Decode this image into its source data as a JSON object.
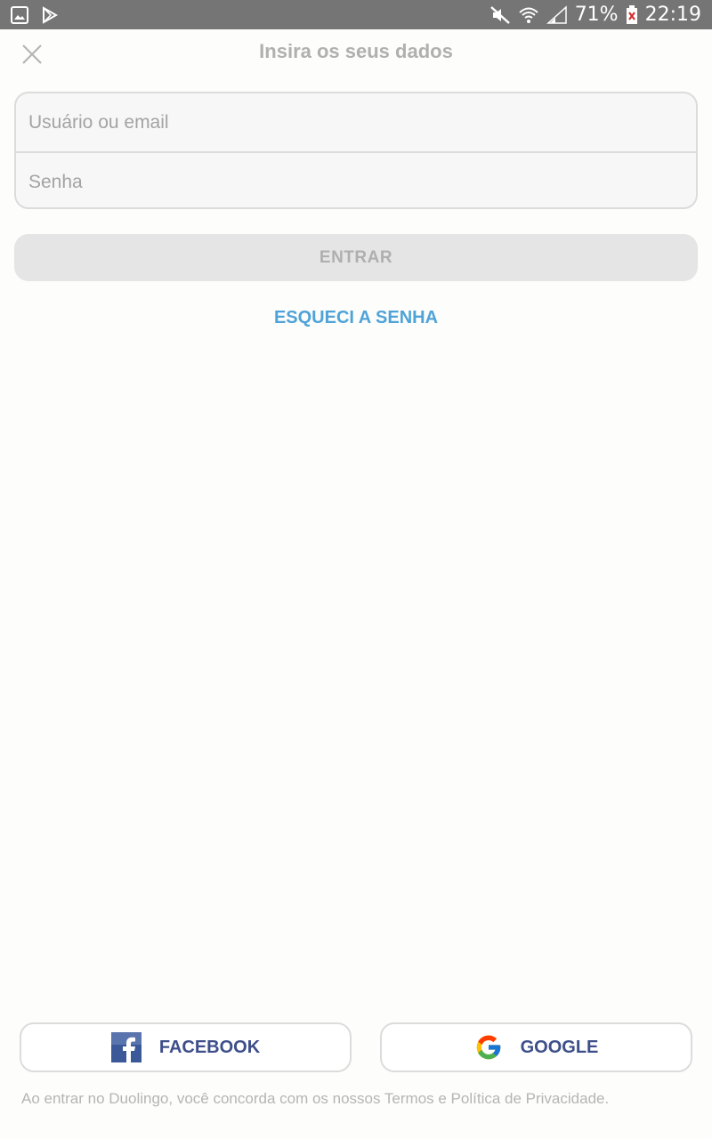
{
  "status_bar": {
    "battery_percent": "71%",
    "time": "22:19"
  },
  "header": {
    "title": "Insira os seus dados"
  },
  "form": {
    "username_placeholder": "Usuário ou email",
    "password_placeholder": "Senha"
  },
  "actions": {
    "login_label": "ENTRAR",
    "forgot_label": "ESQUECI A SENHA"
  },
  "social": {
    "facebook_label": "FACEBOOK",
    "google_label": "GOOGLE"
  },
  "footer": {
    "terms_text": "Ao entrar no Duolingo, você concorda com os nossos Termos e Política de Privacidade."
  },
  "colors": {
    "status_bar": "#757575",
    "link": "#4fa3d8",
    "facebook_blue": "#3b5998",
    "disabled_button": "#e5e5e5"
  }
}
